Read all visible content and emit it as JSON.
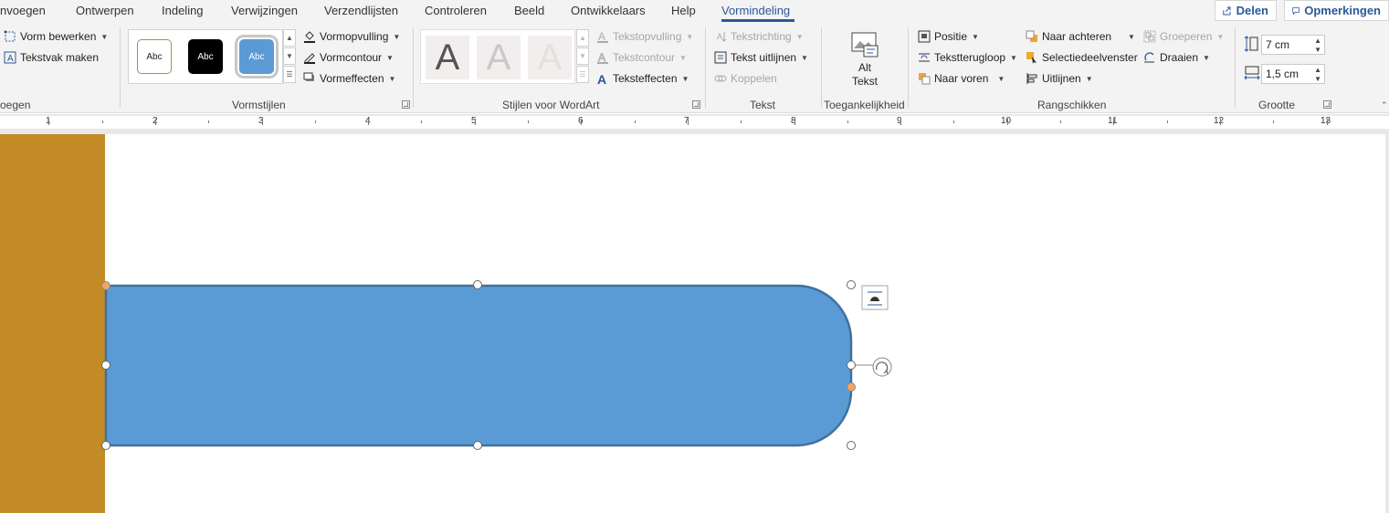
{
  "tabs": [
    {
      "label": "nvoegen"
    },
    {
      "label": "Ontwerpen"
    },
    {
      "label": "Indeling"
    },
    {
      "label": "Verwijzingen"
    },
    {
      "label": "Verzendlijsten"
    },
    {
      "label": "Controleren"
    },
    {
      "label": "Beeld"
    },
    {
      "label": "Ontwikkelaars"
    },
    {
      "label": "Help"
    },
    {
      "label": "Vormindeling"
    }
  ],
  "share": {
    "label": "Delen"
  },
  "comments": {
    "label": "Opmerkingen"
  },
  "insert_group": {
    "edit_shape": "Vorm bewerken",
    "textbox": "Tekstvak maken",
    "label": "oegen"
  },
  "shape_styles": {
    "swatches": [
      "Abc",
      "Abc",
      "Abc"
    ],
    "fill": "Vormopvulling",
    "outline": "Vormcontour",
    "effects": "Vormeffecten",
    "label": "Vormstijlen"
  },
  "wordart": {
    "letters": [
      "A",
      "A",
      "A"
    ],
    "text_fill": "Tekstopvulling",
    "text_outline": "Tekstcontour",
    "text_effects": "Teksteffecten",
    "label": "Stijlen voor WordArt"
  },
  "text_group": {
    "direction": "Tekstrichting",
    "align": "Tekst uitlijnen",
    "link": "Koppelen",
    "label": "Tekst"
  },
  "accessibility": {
    "alt_line1": "Alt",
    "alt_line2": "Tekst",
    "label": "Toegankelijkheid"
  },
  "arrange": {
    "position": "Positie",
    "wrap": "Tekstterugloop",
    "forward": "Naar voren",
    "backward": "Naar achteren",
    "selection_pane": "Selectiedeelvenster",
    "align": "Uitlijnen",
    "group": "Groeperen",
    "rotate": "Draaien",
    "label": "Rangschikken"
  },
  "size": {
    "height": "7 cm",
    "width": "1,5 cm",
    "label": "Grootte"
  },
  "ruler_numbers": [
    "1",
    "2",
    "3",
    "4",
    "5",
    "6",
    "7",
    "8",
    "9",
    "10",
    "11",
    "12",
    "13"
  ],
  "colors": {
    "accent": "#2b579a",
    "shape_fill": "#5b9bd5",
    "shape_stroke": "#41719c",
    "sidebar": "#c28b25",
    "handle_orange": "#f4a460"
  }
}
